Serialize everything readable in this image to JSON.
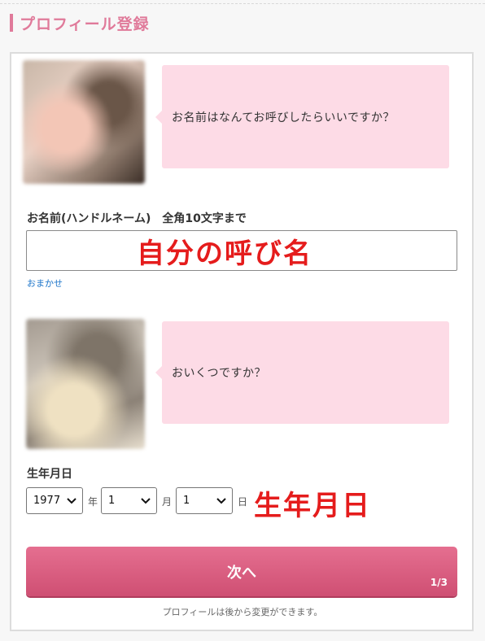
{
  "section": {
    "title": "プロフィール登録"
  },
  "q1": {
    "bubble": "お名前はなんてお呼びしたらいいですか？"
  },
  "name_field": {
    "label": "お名前(ハンドルネーム)　全角10文字まで",
    "value": "",
    "placeholder": "",
    "omakase": "おまかせ"
  },
  "q2": {
    "bubble": "おいくつですか？"
  },
  "birth": {
    "label": "生年月日",
    "year": "1977",
    "year_unit": "年",
    "month": "1",
    "month_unit": "月",
    "day": "1",
    "day_unit": "日"
  },
  "annotations": {
    "name": "自分の呼び名",
    "birth": "生年月日"
  },
  "next": {
    "label": "次へ",
    "step": "1/3"
  },
  "footer_note": "プロフィールは後から変更ができます。",
  "colors": {
    "accent": "#e07a9a",
    "bubble": "#fddbe6",
    "button": "#d95b7e",
    "annotation": "#e51c1c"
  }
}
